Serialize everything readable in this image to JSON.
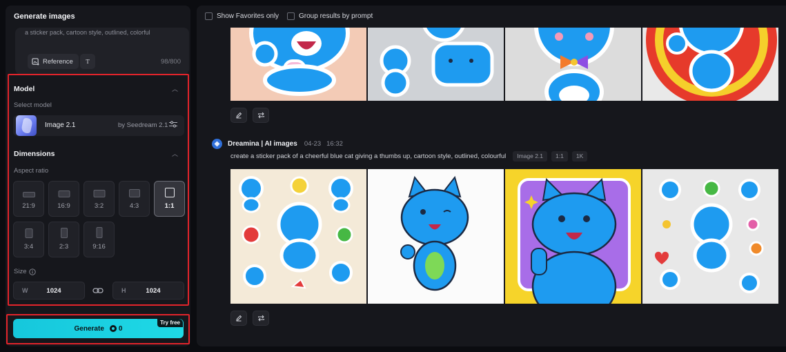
{
  "left_panel": {
    "title": "Generate images",
    "prompt_preview": "a sticker pack, cartoon style, outlined, colorful",
    "reference_label": "Reference",
    "text_tool_label": "T",
    "char_counter": "98/800",
    "model_section": {
      "title": "Model",
      "select_label": "Select model",
      "model_name": "Image 2.1",
      "model_provider": "by Seedream 2.1"
    },
    "dimensions_section": {
      "title": "Dimensions",
      "aspect_label": "Aspect ratio",
      "ratios": [
        "21:9",
        "16:9",
        "3:2",
        "4:3",
        "1:1",
        "3:4",
        "2:3",
        "9:16"
      ],
      "selected_ratio": "1:1",
      "size_label": "Size",
      "width_key": "W",
      "width_value": "1024",
      "height_key": "H",
      "height_value": "1024"
    },
    "generate": {
      "label": "Generate",
      "credits": "0",
      "badge": "Try free"
    }
  },
  "results": {
    "filters": {
      "favorites_label": "Show Favorites only",
      "group_label": "Group results by prompt"
    },
    "entry": {
      "author": "Dreamina | AI images",
      "date": "04-23",
      "time": "16:32",
      "prompt": "create a sticker pack of a cheerful blue cat giving a thumbs up, cartoon style, outlined, colourful",
      "tags": [
        "Image 2.1",
        "1:1",
        "1K"
      ]
    }
  },
  "colors": {
    "accent": "#1fd9e6",
    "highlight_border": "#e3242b",
    "cat_blue": "#1e9bf0"
  },
  "icons": {
    "reference": "image-plus-icon",
    "settings": "sliders-icon",
    "chevron": "chevron-up-icon",
    "info": "info-icon",
    "link": "link-icon",
    "edit": "pencil-icon",
    "regenerate": "repeat-icon",
    "coin": "coin-icon"
  }
}
